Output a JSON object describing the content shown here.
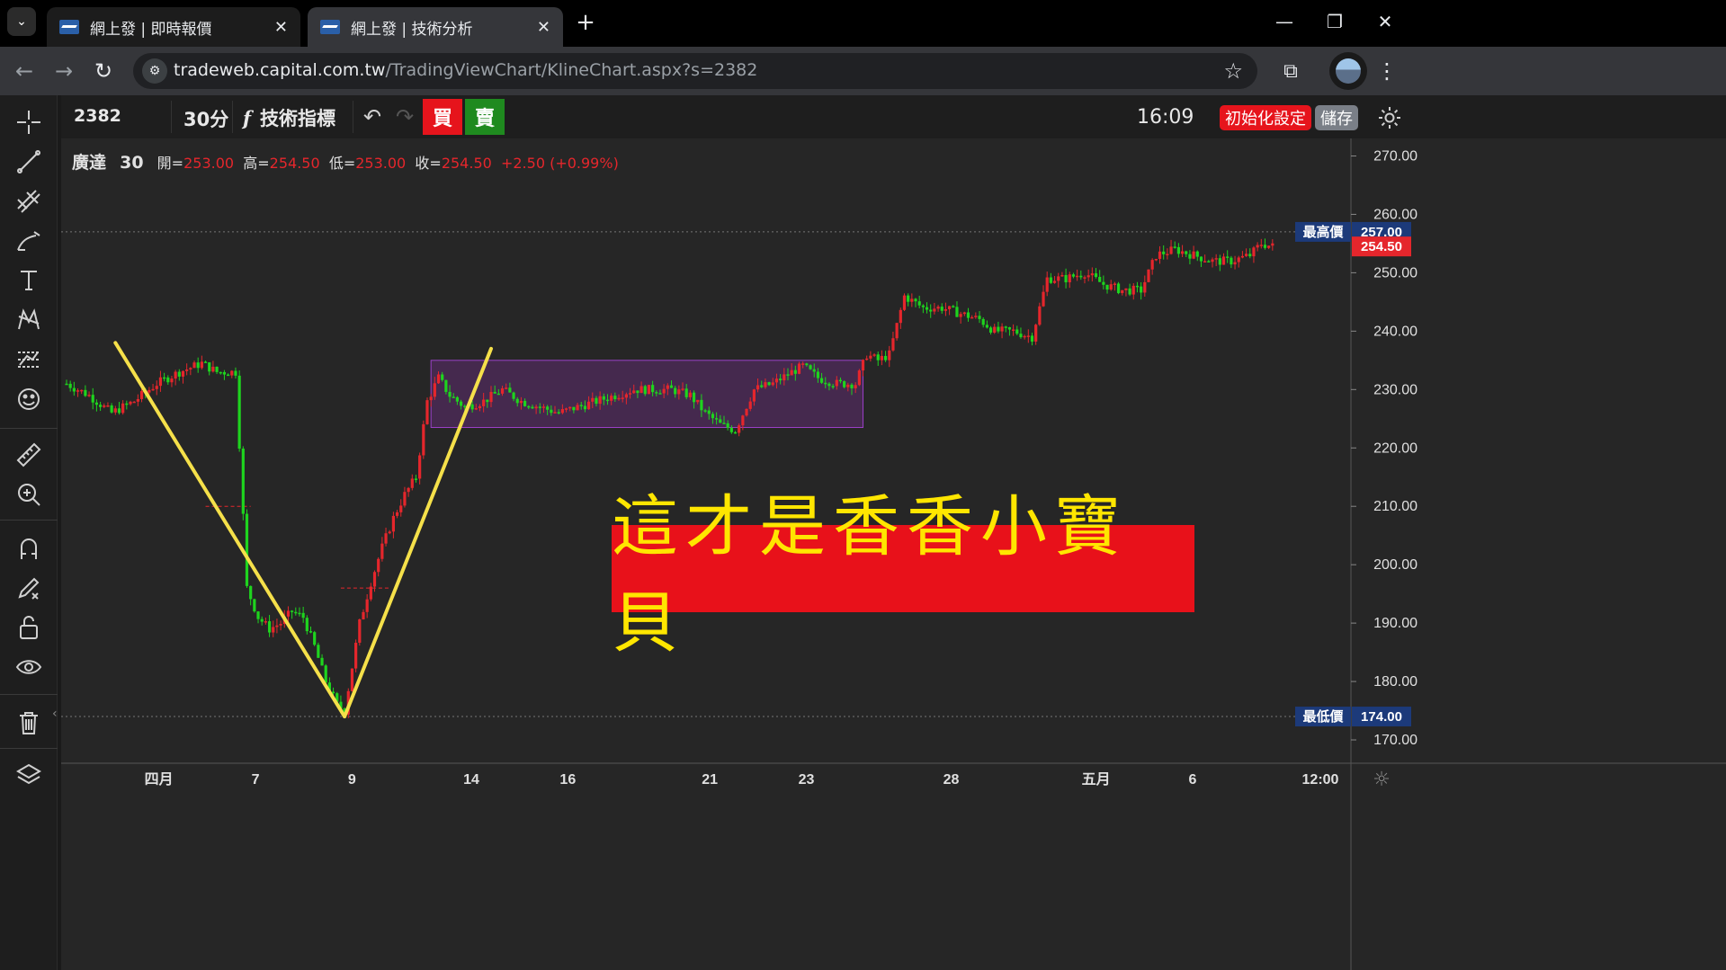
{
  "browser": {
    "tabs": [
      {
        "title": "網上發 | 即時報價",
        "close": "✕"
      },
      {
        "title": "網上發 | 技術分析",
        "close": "✕"
      }
    ],
    "new_tab": "+",
    "url_host": "tradeweb.capital.com.tw",
    "url_path": "/TradingViewChart/KlineChart.aspx?s=2382"
  },
  "toolbar": {
    "symbol": "2382",
    "interval": "30分",
    "indicators_icon": "f",
    "indicators_label": "技術指標",
    "buy_label": "買",
    "sell_label": "賣",
    "time": "16:09",
    "reset_label": "初始化設定",
    "save_label": "儲存"
  },
  "legend": {
    "name": "廣達",
    "interval": "30",
    "open_label": "開=",
    "open": "253.00",
    "high_label": "高=",
    "high": "254.50",
    "low_label": "低=",
    "low": "253.00",
    "close_label": "收=",
    "close": "254.50",
    "change": "+2.50 (+0.99%)"
  },
  "banner_text": "這才是香香小寶貝",
  "colors": {
    "up": "#e5262c",
    "down": "#1ed41e",
    "yellow_line": "#f5e04a",
    "box_border": "#9b40c8",
    "box_fill": "#4b2a56",
    "banner_bg": "#e8111a",
    "banner_text": "#ffe600",
    "price_tag_blue": "#1c3a7a"
  },
  "chart_data": {
    "type": "candlestick",
    "y_ticks": [
      "270.00",
      "260.00",
      "250.00",
      "240.00",
      "230.00",
      "220.00",
      "210.00",
      "200.00",
      "190.00",
      "180.00",
      "170.00"
    ],
    "x_ticks": [
      "四月",
      "7",
      "9",
      "14",
      "16",
      "21",
      "23",
      "28",
      "五月",
      "6",
      "12:00"
    ],
    "ylim": [
      166,
      273
    ],
    "high_marker": {
      "label": "最高價",
      "value": "257.00"
    },
    "low_marker": {
      "label": "最低價",
      "value": "174.00"
    },
    "last_price": "254.50",
    "price_path": [
      [
        0,
        231
      ],
      [
        6,
        229
      ],
      [
        12,
        226
      ],
      [
        18,
        228
      ],
      [
        24,
        231
      ],
      [
        30,
        233
      ],
      [
        36,
        234.5
      ],
      [
        40,
        233
      ],
      [
        45,
        233
      ],
      [
        48,
        196
      ],
      [
        51,
        191
      ],
      [
        54,
        189
      ],
      [
        57,
        190
      ],
      [
        60,
        192
      ],
      [
        63,
        191
      ],
      [
        66,
        186
      ],
      [
        69,
        180
      ],
      [
        72,
        176
      ],
      [
        74,
        175
      ],
      [
        78,
        190
      ],
      [
        81,
        197
      ],
      [
        84,
        203
      ],
      [
        87,
        208
      ],
      [
        90,
        212
      ],
      [
        93,
        215
      ],
      [
        96,
        228
      ],
      [
        99,
        232
      ],
      [
        102,
        229
      ],
      [
        106,
        227
      ],
      [
        111,
        228
      ],
      [
        116,
        230
      ],
      [
        121,
        228
      ],
      [
        126,
        227
      ],
      [
        131,
        226
      ],
      [
        136,
        227
      ],
      [
        141,
        228
      ],
      [
        146,
        229
      ],
      [
        151,
        230
      ],
      [
        156,
        230
      ],
      [
        161,
        230
      ],
      [
        166,
        229
      ],
      [
        170,
        226
      ],
      [
        174,
        224
      ],
      [
        178,
        223
      ],
      [
        183,
        230
      ],
      [
        188,
        231
      ],
      [
        193,
        233
      ],
      [
        196,
        234
      ],
      [
        200,
        232
      ],
      [
        205,
        231
      ],
      [
        210,
        231
      ],
      [
        213,
        236
      ],
      [
        216,
        235
      ],
      [
        219,
        236
      ],
      [
        223,
        246
      ],
      [
        228,
        244
      ],
      [
        233,
        244
      ],
      [
        238,
        243
      ],
      [
        243,
        242
      ],
      [
        247,
        240
      ],
      [
        252,
        240
      ],
      [
        257,
        239
      ],
      [
        261,
        249
      ],
      [
        266,
        249
      ],
      [
        271,
        250
      ],
      [
        276,
        248
      ],
      [
        281,
        247
      ],
      [
        286,
        247
      ],
      [
        290,
        253
      ],
      [
        295,
        254
      ],
      [
        300,
        253
      ],
      [
        305,
        252
      ],
      [
        310,
        252
      ],
      [
        315,
        253
      ],
      [
        318,
        255
      ],
      [
        321,
        254.5
      ]
    ],
    "annotations": {
      "yellow_lines": [
        [
          [
            13,
            238
          ],
          [
            74,
            174
          ]
        ],
        [
          [
            74,
            174
          ],
          [
            113,
            237
          ]
        ]
      ],
      "box": {
        "x0": 97,
        "x1": 212,
        "y0": 223.5,
        "y1": 235
      },
      "dashed_levels": [
        {
          "x0": 37,
          "x1": 49,
          "y": 210
        },
        {
          "x0": 73,
          "x1": 86,
          "y": 196
        }
      ]
    }
  }
}
